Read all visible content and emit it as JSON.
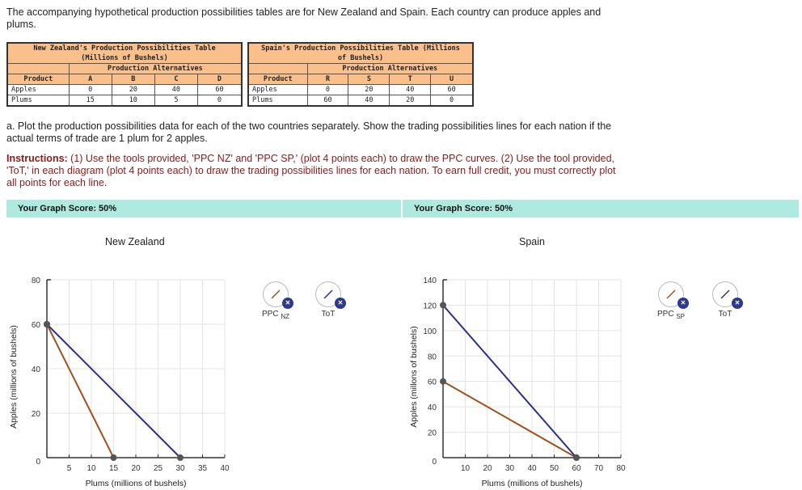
{
  "intro_text": "The accompanying hypothetical production possibilities tables are for New Zealand and Spain. Each country can produce apples and plums.",
  "tables": [
    {
      "title_line1": "New Zealand's Production Possibilities Table",
      "title_line2": "(Millions of Bushels)",
      "subheader": "Production Alternatives",
      "product_header": "Product",
      "columns": [
        "A",
        "B",
        "C",
        "D"
      ],
      "rows": [
        {
          "label": "Apples",
          "values": [
            "0",
            "20",
            "40",
            "60"
          ]
        },
        {
          "label": "Plums",
          "values": [
            "15",
            "10",
            "5",
            "0"
          ]
        }
      ]
    },
    {
      "title_line1": "Spain's Production Possibilities Table (Millions",
      "title_line2": "of Bushels)",
      "subheader": "Production Alternatives",
      "product_header": "Product",
      "columns": [
        "R",
        "S",
        "T",
        "U"
      ],
      "rows": [
        {
          "label": "Apples",
          "values": [
            "0",
            "20",
            "40",
            "60"
          ]
        },
        {
          "label": "Plums",
          "values": [
            "60",
            "40",
            "20",
            "0"
          ]
        }
      ]
    }
  ],
  "question": "a. Plot the production possibilities data for each of the two countries separately. Show the trading possibilities lines for each nation if the actual terms of trade are 1 plum for 2 apples.",
  "instructions_label": "Instructions:",
  "instructions_text": " (1) Use the tools provided, 'PPC NZ' and 'PPC SP,' (plot 4 points each) to draw the PPC curves. (2) Use the tool provided, 'ToT,' in each diagram (plot 4 points each) to draw the trading possibilities lines for each nation. To earn full credit, you must correctly plot all points for each line.",
  "scores": [
    "Your Graph Score: 50%",
    "Your Graph Score: 50%"
  ],
  "colors": {
    "ppc": "#a0521c",
    "tot": "#2b2f8f",
    "banner": "#aeeadf",
    "table_header": "#f9c08b",
    "point": "#555555"
  },
  "tools": {
    "nz": [
      {
        "label": "PPC",
        "sub": "NZ",
        "icon": "line-tool-icon",
        "color": "#a0521c"
      },
      {
        "label": "ToT",
        "sub": "",
        "icon": "line-tool-icon",
        "color": "#2b2f8f"
      }
    ],
    "sp": [
      {
        "label": "PPC",
        "sub": "SP",
        "icon": "line-tool-icon",
        "color": "#a0521c"
      },
      {
        "label": "ToT",
        "sub": "",
        "icon": "line-tool-icon",
        "color": "#2b2f8f"
      }
    ]
  },
  "chart_data": [
    {
      "type": "line",
      "title": "New Zealand",
      "xlabel": "Plums (millions of bushels)",
      "ylabel": "Apples (millions of bushels)",
      "xlim": [
        0,
        40
      ],
      "ylim": [
        0,
        80
      ],
      "xticks": [
        5,
        10,
        15,
        20,
        25,
        30,
        35,
        40
      ],
      "yticks": [
        0,
        20,
        40,
        60,
        80
      ],
      "grid": true,
      "series": [
        {
          "name": "PPC NZ",
          "color": "#a0521c",
          "points": [
            [
              0,
              60
            ],
            [
              15,
              0
            ]
          ]
        },
        {
          "name": "ToT",
          "color": "#2b2f8f",
          "points": [
            [
              0,
              60
            ],
            [
              30,
              0
            ]
          ]
        }
      ]
    },
    {
      "type": "line",
      "title": "Spain",
      "xlabel": "Plums (millions of bushels)",
      "ylabel": "Apples (millons of bushels)",
      "xlim": [
        0,
        80
      ],
      "ylim": [
        0,
        140
      ],
      "xticks": [
        10,
        20,
        30,
        40,
        50,
        60,
        70,
        80
      ],
      "yticks": [
        0,
        20,
        40,
        60,
        80,
        100,
        120,
        140
      ],
      "grid": true,
      "series": [
        {
          "name": "PPC SP",
          "color": "#a0521c",
          "points": [
            [
              0,
              60
            ],
            [
              60,
              0
            ]
          ]
        },
        {
          "name": "ToT",
          "color": "#2b2f8f",
          "points": [
            [
              0,
              120
            ],
            [
              60,
              0
            ]
          ]
        }
      ]
    }
  ]
}
